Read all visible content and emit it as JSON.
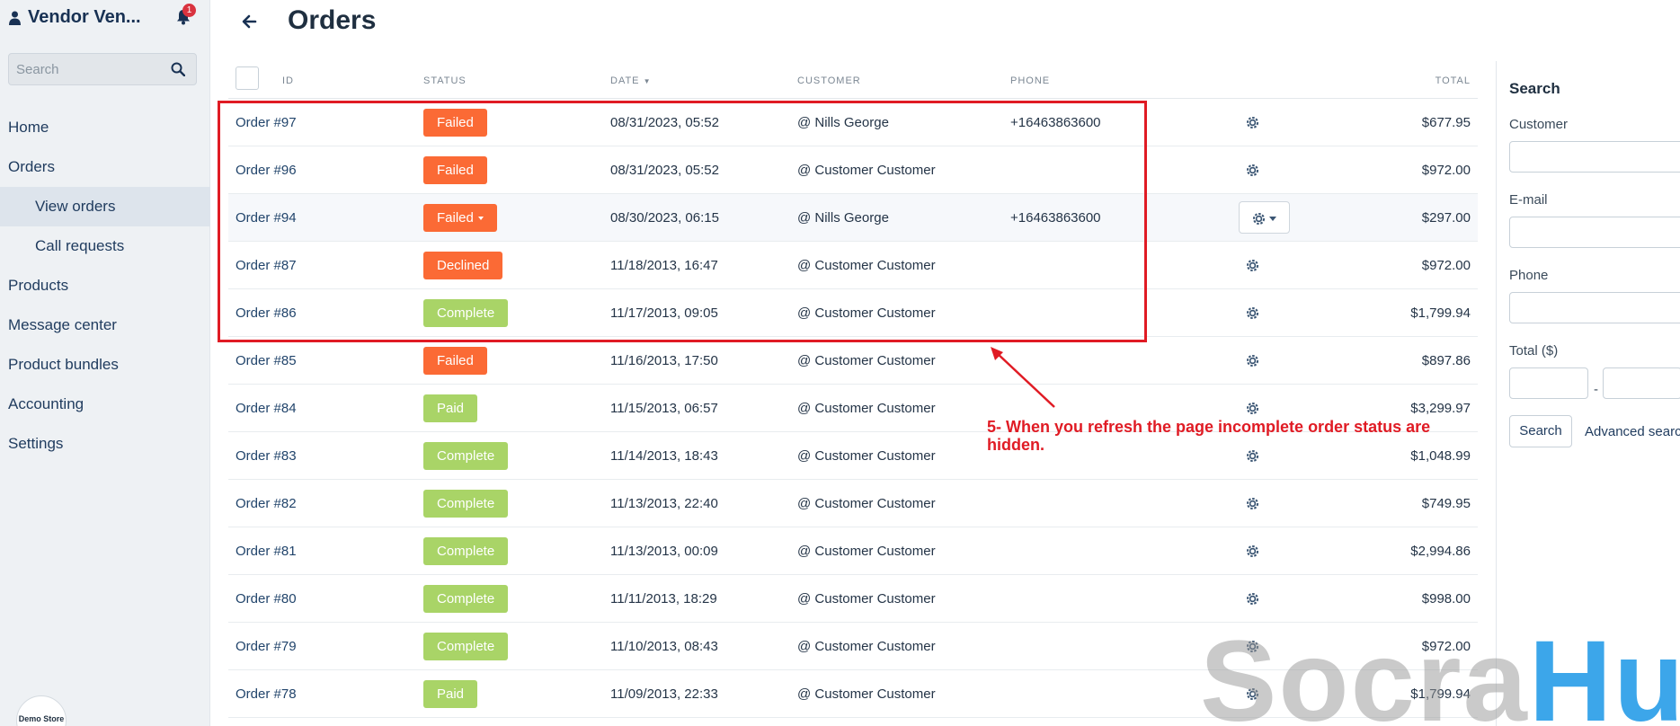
{
  "sidebar": {
    "vendor_name": "Vendor Ven...",
    "notification_count": "1",
    "search_placeholder": "Search",
    "nav": {
      "home": "Home",
      "orders": "Orders",
      "view_orders": "View orders",
      "call_requests": "Call requests",
      "products": "Products",
      "message_center": "Message center",
      "product_bundles": "Product bundles",
      "accounting": "Accounting",
      "settings": "Settings"
    },
    "demo_badge": "Demo Store"
  },
  "header": {
    "title": "Orders"
  },
  "table": {
    "columns": {
      "id": "ID",
      "status": "STATUS",
      "date": "DATE",
      "customer": "CUSTOMER",
      "phone": "PHONE",
      "total": "TOTAL"
    },
    "rows": [
      {
        "id": "Order #97",
        "status": "Failed",
        "date": "08/31/2023, 05:52",
        "customer": "@ Nills George",
        "phone": "+16463863600",
        "total": "$677.95"
      },
      {
        "id": "Order #96",
        "status": "Failed",
        "date": "08/31/2023, 05:52",
        "customer": "@ Customer Customer",
        "phone": "",
        "total": "$972.00"
      },
      {
        "id": "Order #94",
        "status": "Failed",
        "date": "08/30/2023, 06:15",
        "customer": "@ Nills George",
        "phone": "+16463863600",
        "total": "$297.00"
      },
      {
        "id": "Order #87",
        "status": "Declined",
        "date": "11/18/2013, 16:47",
        "customer": "@ Customer Customer",
        "phone": "",
        "total": "$972.00"
      },
      {
        "id": "Order #86",
        "status": "Complete",
        "date": "11/17/2013, 09:05",
        "customer": "@ Customer Customer",
        "phone": "",
        "total": "$1,799.94"
      },
      {
        "id": "Order #85",
        "status": "Failed",
        "date": "11/16/2013, 17:50",
        "customer": "@ Customer Customer",
        "phone": "",
        "total": "$897.86"
      },
      {
        "id": "Order #84",
        "status": "Paid",
        "date": "11/15/2013, 06:57",
        "customer": "@ Customer Customer",
        "phone": "",
        "total": "$3,299.97"
      },
      {
        "id": "Order #83",
        "status": "Complete",
        "date": "11/14/2013, 18:43",
        "customer": "@ Customer Customer",
        "phone": "",
        "total": "$1,048.99"
      },
      {
        "id": "Order #82",
        "status": "Complete",
        "date": "11/13/2013, 22:40",
        "customer": "@ Customer Customer",
        "phone": "",
        "total": "$749.95"
      },
      {
        "id": "Order #81",
        "status": "Complete",
        "date": "11/13/2013, 00:09",
        "customer": "@ Customer Customer",
        "phone": "",
        "total": "$2,994.86"
      },
      {
        "id": "Order #80",
        "status": "Complete",
        "date": "11/11/2013, 18:29",
        "customer": "@ Customer Customer",
        "phone": "",
        "total": "$998.00"
      },
      {
        "id": "Order #79",
        "status": "Complete",
        "date": "11/10/2013, 08:43",
        "customer": "@ Customer Customer",
        "phone": "",
        "total": "$972.00"
      },
      {
        "id": "Order #78",
        "status": "Paid",
        "date": "11/09/2013, 22:33",
        "customer": "@ Customer Customer",
        "phone": "",
        "total": "$1,799.94"
      }
    ],
    "status_colors": {
      "Failed": "#fb6a35",
      "Declined": "#fb6a35",
      "Complete": "#a9d467",
      "Paid": "#a9d467"
    }
  },
  "search_panel": {
    "title": "Search",
    "customer_label": "Customer",
    "email_label": "E-mail",
    "phone_label": "Phone",
    "total_label": "Total ($)",
    "search_button": "Search",
    "advanced_link": "Advanced search"
  },
  "annotation": {
    "text": "5- When you refresh the page incomplete order status are hidden.",
    "color": "#e01b24"
  },
  "watermark": {
    "part1": "Socra",
    "part2": "Hub"
  }
}
